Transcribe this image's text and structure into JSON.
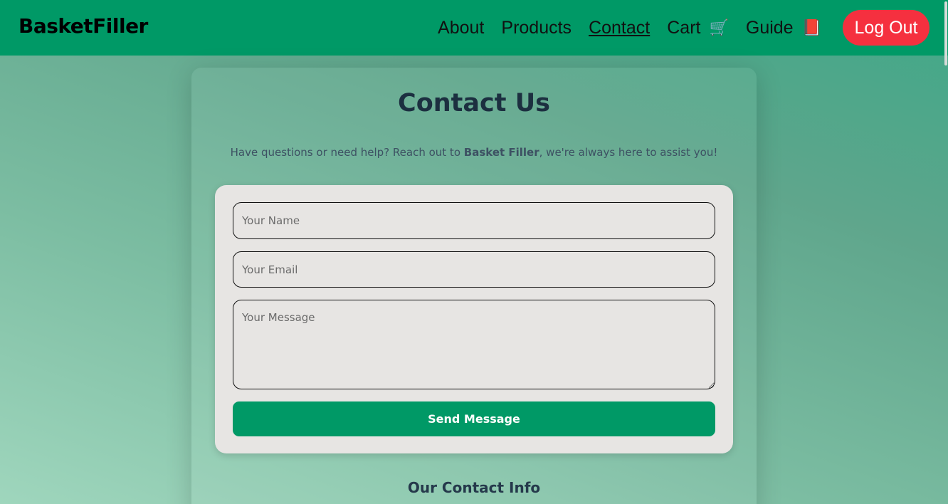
{
  "brand": "BasketFiller",
  "nav": {
    "about": "About",
    "products": "Products",
    "contact": "Contact",
    "cart": "Cart",
    "cart_icon": "🛒",
    "guide": "Guide",
    "guide_icon": "📕",
    "logout": "Log Out"
  },
  "page": {
    "title": "Contact Us",
    "subtitle_pre": "Have questions or need help? Reach out to ",
    "subtitle_brand": "Basket Filler",
    "subtitle_post": ", we're always here to assist you!"
  },
  "form": {
    "name_placeholder": "Your Name",
    "email_placeholder": "Your Email",
    "message_placeholder": "Your Message",
    "send_label": "Send Message"
  },
  "info": {
    "title": "Our Contact Info"
  },
  "colors": {
    "accent": "#009966",
    "logout": "#f5303f",
    "title": "#1c2f40"
  }
}
